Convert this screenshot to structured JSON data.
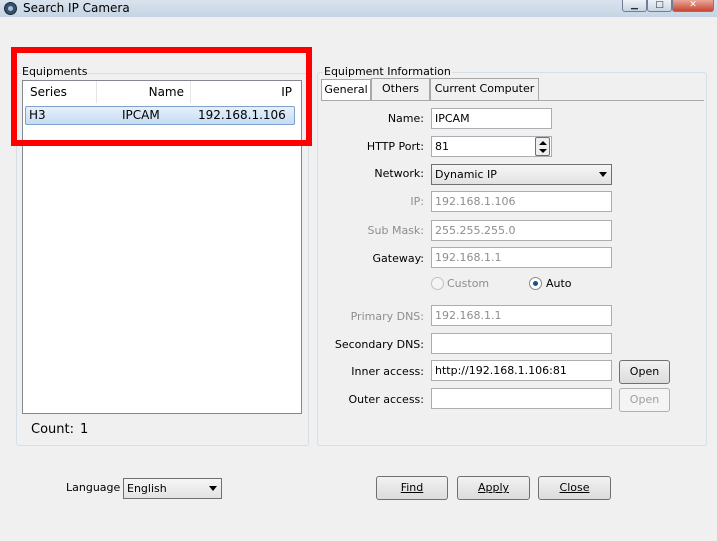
{
  "window": {
    "title": "Search IP Camera",
    "minimize": "▁",
    "maximize": "□",
    "close": "✕"
  },
  "equipments": {
    "group_label": "Equipments",
    "columns": [
      "Series",
      "Name",
      "IP"
    ],
    "rows": [
      {
        "series": "H3",
        "name": "IPCAM",
        "ip": "192.168.1.106"
      }
    ],
    "count_label": "Count:",
    "count": "1"
  },
  "info": {
    "group_label": "Equipment Information",
    "tabs": [
      "General",
      "Others",
      "Current Computer"
    ],
    "name_label": "Name:",
    "name_value": "IPCAM",
    "port_label": "HTTP Port:",
    "port_value": "81",
    "network_label": "Network:",
    "network_value": "Dynamic IP",
    "ip_label": "IP:",
    "ip_value": "192.168.1.106",
    "mask_label": "Sub Mask:",
    "mask_value": "255.255.255.0",
    "gateway_label": "Gateway:",
    "gateway_value": "192.168.1.1",
    "dns_custom": "Custom",
    "dns_auto": "Auto",
    "pdns_label": "Primary DNS:",
    "pdns_value": "192.168.1.1",
    "sdns_label": "Secondary DNS:",
    "sdns_value": "",
    "inner_label": "Inner access:",
    "inner_value": "http://192.168.1.106:81",
    "outer_label": "Outer access:",
    "outer_value": "",
    "open_label": "Open"
  },
  "footer": {
    "language_label": "Language",
    "language_value": "English",
    "find_label": "Find",
    "apply_label": "Apply",
    "close_label": "Close"
  },
  "colors": {
    "highlight": "#ff0000",
    "selection": "#cfe3f9"
  }
}
